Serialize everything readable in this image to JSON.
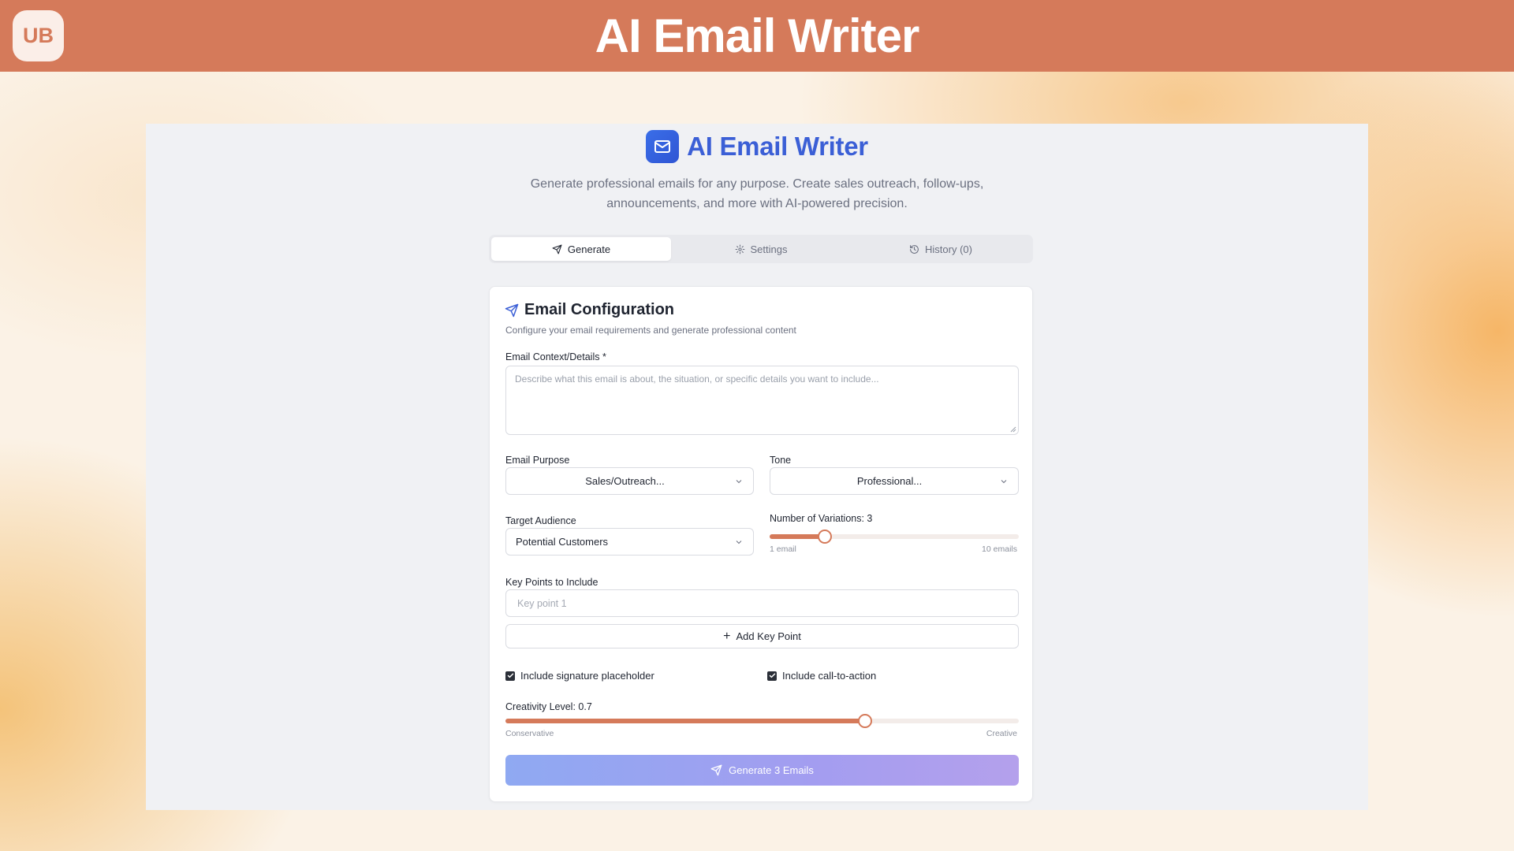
{
  "banner": {
    "logo": "UB",
    "title": "AI Email Writer"
  },
  "app": {
    "title": "AI Email Writer",
    "title_icon": "mail-icon",
    "description": "Generate professional emails for any purpose. Create sales outreach, follow-ups, announcements, and more with AI-powered precision."
  },
  "tabs": [
    {
      "label": "Generate",
      "icon": "send-icon",
      "active": true
    },
    {
      "label": "Settings",
      "icon": "gear-icon",
      "active": false
    },
    {
      "label": "History (0)",
      "icon": "history-icon",
      "active": false
    }
  ],
  "card": {
    "title": "Email Configuration",
    "subtitle": "Configure your email requirements and generate professional content"
  },
  "form": {
    "context_label": "Email Context/Details *",
    "context_placeholder": "Describe what this email is about, the situation, or specific details you want to include...",
    "purpose_label": "Email Purpose",
    "purpose_value": "Sales/Outreach...",
    "tone_label": "Tone",
    "tone_value": "Professional...",
    "audience_label": "Target Audience",
    "audience_value": "Potential Customers",
    "variations_label": "Number of Variations: 3",
    "variations": {
      "value": 3,
      "min": 1,
      "max": 10,
      "min_label": "1 email",
      "max_label": "10 emails"
    },
    "keypoints_label": "Key Points to Include",
    "keypoint_placeholder": "Key point 1",
    "add_keypoint_label": "Add Key Point",
    "signature_label": "Include signature placeholder",
    "signature_checked": true,
    "cta_label": "Include call-to-action",
    "cta_checked": true,
    "creativity_label": "Creativity Level: 0.7",
    "creativity": {
      "value": 0.7,
      "min": 0,
      "max": 1,
      "min_label": "Conservative",
      "max_label": "Creative"
    },
    "generate_label": "Generate 3 Emails"
  },
  "colors": {
    "banner": "#d57a5a",
    "accent": "#3b5fd6",
    "slider": "#d57a5a"
  }
}
